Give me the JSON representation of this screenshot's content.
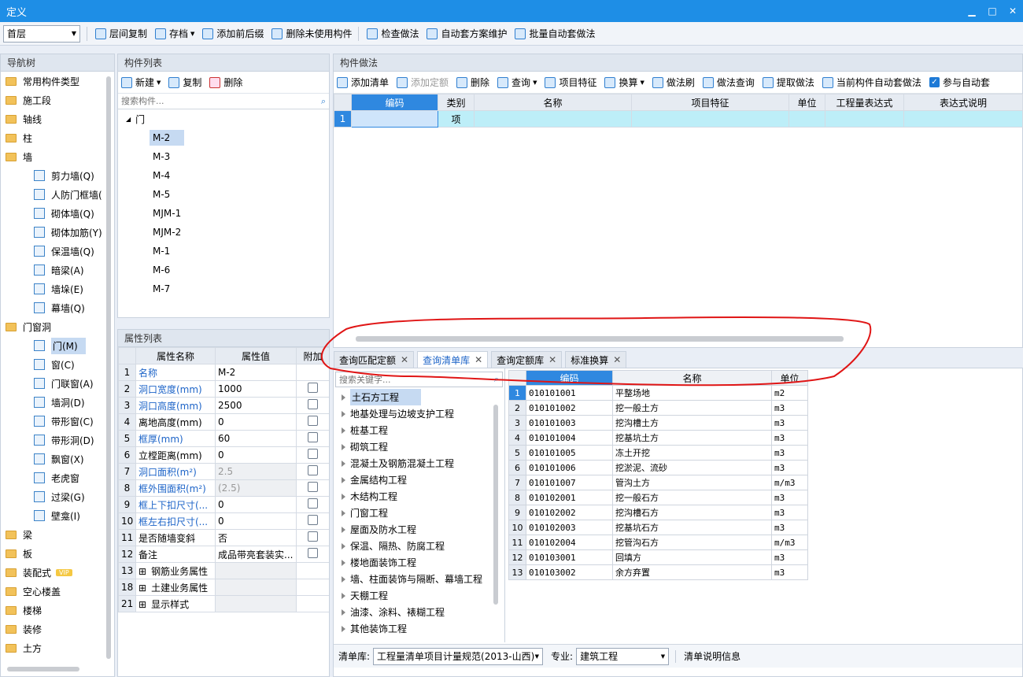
{
  "window": {
    "title": "定义",
    "minimize": "▁",
    "maximize": "□",
    "close": "✕"
  },
  "toolbar": {
    "floor": "首层",
    "buttons": [
      "层间复制",
      "存档",
      "添加前后缀",
      "删除未使用构件",
      "检查做法",
      "自动套方案维护",
      "批量自动套做法"
    ]
  },
  "nav": {
    "title": "导航树",
    "items": [
      {
        "label": "常用构件类型",
        "level": 0
      },
      {
        "label": "施工段",
        "level": 0
      },
      {
        "label": "轴线",
        "level": 0
      },
      {
        "label": "柱",
        "level": 0
      },
      {
        "label": "墙",
        "level": 0
      },
      {
        "label": "剪力墙(Q)",
        "level": 1
      },
      {
        "label": "人防门框墙(",
        "level": 1
      },
      {
        "label": "砌体墙(Q)",
        "level": 1
      },
      {
        "label": "砌体加筋(Y)",
        "level": 1
      },
      {
        "label": "保温墙(Q)",
        "level": 1
      },
      {
        "label": "暗梁(A)",
        "level": 1
      },
      {
        "label": "墙垛(E)",
        "level": 1
      },
      {
        "label": "幕墙(Q)",
        "level": 1
      },
      {
        "label": "门窗洞",
        "level": 0
      },
      {
        "label": "门(M)",
        "level": 1,
        "selected": true
      },
      {
        "label": "窗(C)",
        "level": 1
      },
      {
        "label": "门联窗(A)",
        "level": 1
      },
      {
        "label": "墙洞(D)",
        "level": 1
      },
      {
        "label": "带形窗(C)",
        "level": 1
      },
      {
        "label": "带形洞(D)",
        "level": 1
      },
      {
        "label": "飘窗(X)",
        "level": 1
      },
      {
        "label": "老虎窗",
        "level": 1
      },
      {
        "label": "过梁(G)",
        "level": 1
      },
      {
        "label": "壁龛(I)",
        "level": 1
      },
      {
        "label": "梁",
        "level": 0
      },
      {
        "label": "板",
        "level": 0
      },
      {
        "label": "装配式",
        "level": 0,
        "badge": "VIP"
      },
      {
        "label": "空心楼盖",
        "level": 0
      },
      {
        "label": "楼梯",
        "level": 0
      },
      {
        "label": "装修",
        "level": 0
      },
      {
        "label": "土方",
        "level": 0
      }
    ]
  },
  "components": {
    "title": "构件列表",
    "new": "新建",
    "copy": "复制",
    "delete": "删除",
    "search_placeholder": "搜索构件...",
    "group": "门",
    "items": [
      "M-2",
      "M-3",
      "M-4",
      "M-5",
      "MJM-1",
      "MJM-2",
      "M-1",
      "M-6",
      "M-7"
    ]
  },
  "props": {
    "title": "属性列表",
    "headers": [
      "属性名称",
      "属性值",
      "附加"
    ],
    "rows": [
      {
        "n": "1",
        "name": "名称",
        "value": "M-2",
        "blue": true,
        "check": false
      },
      {
        "n": "2",
        "name": "洞口宽度(mm)",
        "value": "1000",
        "blue": true,
        "check": true
      },
      {
        "n": "3",
        "name": "洞口高度(mm)",
        "value": "2500",
        "blue": true,
        "check": true
      },
      {
        "n": "4",
        "name": "离地高度(mm)",
        "value": "0",
        "blue": false,
        "check": true
      },
      {
        "n": "5",
        "name": "框厚(mm)",
        "value": "60",
        "blue": true,
        "check": true
      },
      {
        "n": "6",
        "name": "立樘距离(mm)",
        "value": "0",
        "blue": false,
        "check": true
      },
      {
        "n": "7",
        "name": "洞口面积(m²)",
        "value": "2.5",
        "blue": true,
        "check": true,
        "gray": true
      },
      {
        "n": "8",
        "name": "框外围面积(m²)",
        "value": "(2.5)",
        "blue": true,
        "check": true,
        "gray": true
      },
      {
        "n": "9",
        "name": "框上下扣尺寸(...",
        "value": "0",
        "blue": true,
        "check": true
      },
      {
        "n": "10",
        "name": "框左右扣尺寸(...",
        "value": "0",
        "blue": true,
        "check": true
      },
      {
        "n": "11",
        "name": "是否随墙变斜",
        "value": "否",
        "blue": false,
        "check": true
      },
      {
        "n": "12",
        "name": "备注",
        "value": "成品带亮套装实...",
        "blue": false,
        "check": true
      },
      {
        "n": "13",
        "name": "钢筋业务属性",
        "value": "",
        "blue": false,
        "check": false,
        "group": true
      },
      {
        "n": "18",
        "name": "土建业务属性",
        "value": "",
        "blue": false,
        "check": false,
        "group": true
      },
      {
        "n": "21",
        "name": "显示样式",
        "value": "",
        "blue": false,
        "check": false,
        "group": true
      }
    ]
  },
  "method": {
    "title": "构件做法",
    "toolbar": [
      "添加清单",
      "添加定额",
      "删除",
      "查询",
      "项目特征",
      "换算",
      "做法刷",
      "做法查询",
      "提取做法",
      "当前构件自动套做法",
      "参与自动套"
    ],
    "headers": [
      "编码",
      "类别",
      "名称",
      "项目特征",
      "单位",
      "工程量表达式",
      "表达式说明"
    ],
    "rows": [
      {
        "n": "1",
        "code": "",
        "type": "项",
        "name": "",
        "feature": "",
        "unit": "",
        "expr": "",
        "desc": ""
      }
    ]
  },
  "query": {
    "tabs": [
      "查询匹配定额",
      "查询清单库",
      "查询定额库",
      "标准换算"
    ],
    "active_tab": 1,
    "search_placeholder": "搜索关键字...",
    "tree": [
      "土石方工程",
      "地基处理与边坡支护工程",
      "桩基工程",
      "砌筑工程",
      "混凝土及钢筋混凝土工程",
      "金属结构工程",
      "木结构工程",
      "门窗工程",
      "屋面及防水工程",
      "保温、隔热、防腐工程",
      "楼地面装饰工程",
      "墙、柱面装饰与隔断、幕墙工程",
      "天棚工程",
      "油漆、涂料、裱糊工程",
      "其他装饰工程"
    ],
    "headers": [
      "编码",
      "名称",
      "单位"
    ],
    "rows": [
      {
        "n": "1",
        "code": "010101001",
        "name": "平整场地",
        "unit": "m2"
      },
      {
        "n": "2",
        "code": "010101002",
        "name": "挖一般土方",
        "unit": "m3"
      },
      {
        "n": "3",
        "code": "010101003",
        "name": "挖沟槽土方",
        "unit": "m3"
      },
      {
        "n": "4",
        "code": "010101004",
        "name": "挖基坑土方",
        "unit": "m3"
      },
      {
        "n": "5",
        "code": "010101005",
        "name": "冻土开挖",
        "unit": "m3"
      },
      {
        "n": "6",
        "code": "010101006",
        "name": "挖淤泥、流砂",
        "unit": "m3"
      },
      {
        "n": "7",
        "code": "010101007",
        "name": "管沟土方",
        "unit": "m/m3"
      },
      {
        "n": "8",
        "code": "010102001",
        "name": "挖一般石方",
        "unit": "m3"
      },
      {
        "n": "9",
        "code": "010102002",
        "name": "挖沟槽石方",
        "unit": "m3"
      },
      {
        "n": "10",
        "code": "010102003",
        "name": "挖基坑石方",
        "unit": "m3"
      },
      {
        "n": "11",
        "code": "010102004",
        "name": "挖管沟石方",
        "unit": "m/m3"
      },
      {
        "n": "12",
        "code": "010103001",
        "name": "回填方",
        "unit": "m3"
      },
      {
        "n": "13",
        "code": "010103002",
        "name": "余方弃置",
        "unit": "m3"
      }
    ],
    "footer": {
      "lib_label": "清单库:",
      "lib_value": "工程量清单项目计量规范(2013-山西)",
      "major_label": "专业:",
      "major_value": "建筑工程",
      "info": "清单说明信息"
    }
  }
}
